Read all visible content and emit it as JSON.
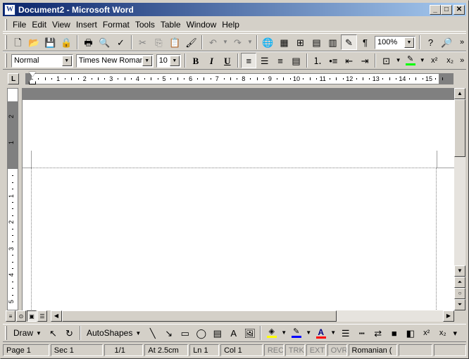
{
  "window": {
    "title": "Document2 - Microsoft Word",
    "app_icon": "W",
    "controls": {
      "minimize": "_",
      "maximize": "□",
      "close": "✕"
    }
  },
  "menu": [
    "File",
    "Edit",
    "View",
    "Insert",
    "Format",
    "Tools",
    "Table",
    "Window",
    "Help"
  ],
  "standard_toolbar": {
    "zoom": "100%",
    "icons": [
      "new-icon",
      "open-icon",
      "save-icon",
      "permission-icon",
      "print-icon",
      "print-preview-icon",
      "spelling-icon",
      "cut-icon",
      "copy-icon",
      "paste-icon",
      "format-painter-icon",
      "undo-icon",
      "redo-icon",
      "hyperlink-icon",
      "tables-borders-icon",
      "insert-table-icon",
      "insert-excel-icon",
      "columns-icon",
      "drawing-icon",
      "show-hide-icon",
      "help-icon",
      "research-icon"
    ]
  },
  "formatting_toolbar": {
    "style": "Normal",
    "font": "Times New Roman",
    "size": "10",
    "bold": "B",
    "italic": "I",
    "underline": "U",
    "superscript": "x²",
    "subscript": "x₂"
  },
  "ruler": {
    "tab_selector": "L",
    "numbers": [
      "1",
      "2",
      "3",
      "4",
      "5",
      "6",
      "7",
      "8",
      "9",
      "10",
      "11",
      "12",
      "13",
      "14",
      "15"
    ],
    "vertical_numbers_top": [
      "2",
      "1"
    ],
    "vertical_numbers": [
      "1",
      "2",
      "3",
      "4",
      "5"
    ]
  },
  "drawing_toolbar": {
    "draw": "Draw",
    "autoshapes": "AutoShapes",
    "superscript": "x²",
    "subscript": "x₂"
  },
  "status": {
    "page": "Page 1",
    "sec": "Sec 1",
    "pages": "1/1",
    "at": "At 2.5cm",
    "ln": "Ln 1",
    "col": "Col 1",
    "rec": "REC",
    "trk": "TRK",
    "ext": "EXT",
    "ovr": "OVR",
    "language": "Romanian ("
  },
  "colors": {
    "titlebar_start": "#0a246a",
    "titlebar_end": "#a6caf0",
    "highlight": "#00ff00",
    "fill": "#ffff00",
    "line": "#0000ff",
    "font": "#ff0000"
  }
}
